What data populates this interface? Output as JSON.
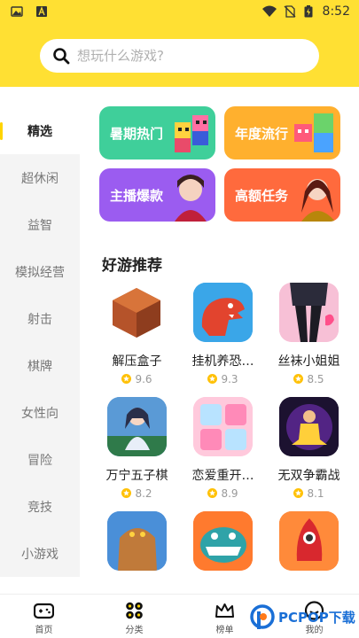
{
  "status_bar": {
    "time": "8:52",
    "left_icons": [
      "image-icon",
      "font-icon"
    ],
    "right_icons": [
      "wifi-icon",
      "no-sim-icon",
      "battery-charging-icon"
    ]
  },
  "search": {
    "placeholder": "想玩什么游戏?"
  },
  "sidebar": {
    "items": [
      {
        "label": "精选",
        "active": true
      },
      {
        "label": "超休闲"
      },
      {
        "label": "益智"
      },
      {
        "label": "模拟经营"
      },
      {
        "label": "射击"
      },
      {
        "label": "棋牌"
      },
      {
        "label": "女性向"
      },
      {
        "label": "冒险"
      },
      {
        "label": "竞技"
      },
      {
        "label": "小游戏"
      }
    ]
  },
  "categories": [
    {
      "label": "暑期热门",
      "color": "#3fcf9a"
    },
    {
      "label": "年度流行",
      "color": "#ffb02e"
    },
    {
      "label": "主播爆款",
      "color": "#9b5cf0"
    },
    {
      "label": "高额任务",
      "color": "#ff6a3d"
    }
  ],
  "section": {
    "title": "好游推荐"
  },
  "games": [
    {
      "name": "解压盒子",
      "rating": "9.6",
      "icon": "brown-cube-icon"
    },
    {
      "name": "挂机养恐…",
      "rating": "9.3",
      "icon": "red-dinosaur-icon"
    },
    {
      "name": "丝袜小姐姐",
      "rating": "8.5",
      "icon": "girl-legs-icon"
    },
    {
      "name": "万宁五子棋",
      "rating": "8.2",
      "icon": "warrior-girl-icon"
    },
    {
      "name": "恋爱重开…",
      "rating": "8.9",
      "icon": "pink-tile-icon"
    },
    {
      "name": "无双争霸战",
      "rating": "8.1",
      "icon": "meditating-hero-icon"
    },
    {
      "name": "",
      "rating": "",
      "icon": "stone-golem-icon"
    },
    {
      "name": "",
      "rating": "",
      "icon": "orange-dinosaur-icon"
    },
    {
      "name": "",
      "rating": "",
      "icon": "red-rocket-icon"
    }
  ],
  "tabbar": {
    "items": [
      {
        "label": "首页",
        "icon": "gamepad-icon"
      },
      {
        "label": "分类",
        "icon": "grid-icon"
      },
      {
        "label": "榜单",
        "icon": "crown-icon"
      },
      {
        "label": "",
        "icon": "blank"
      },
      {
        "label": "我的",
        "icon": "smile-icon"
      }
    ]
  },
  "watermark": {
    "text": "PCPOP下载"
  },
  "colors": {
    "brand_yellow": "#ffe033",
    "star": "#ffc107",
    "text_dark": "#222222",
    "text_gray": "#999999"
  }
}
